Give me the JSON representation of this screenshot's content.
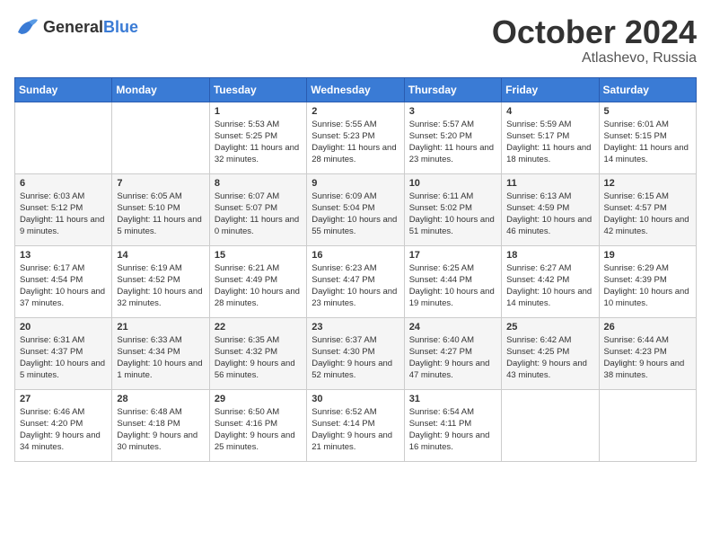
{
  "header": {
    "logo_general": "General",
    "logo_blue": "Blue",
    "month": "October 2024",
    "location": "Atlashevo, Russia"
  },
  "days_of_week": [
    "Sunday",
    "Monday",
    "Tuesday",
    "Wednesday",
    "Thursday",
    "Friday",
    "Saturday"
  ],
  "weeks": [
    [
      {
        "day": "",
        "sunrise": "",
        "sunset": "",
        "daylight": ""
      },
      {
        "day": "",
        "sunrise": "",
        "sunset": "",
        "daylight": ""
      },
      {
        "day": "1",
        "sunrise": "Sunrise: 5:53 AM",
        "sunset": "Sunset: 5:25 PM",
        "daylight": "Daylight: 11 hours and 32 minutes."
      },
      {
        "day": "2",
        "sunrise": "Sunrise: 5:55 AM",
        "sunset": "Sunset: 5:23 PM",
        "daylight": "Daylight: 11 hours and 28 minutes."
      },
      {
        "day": "3",
        "sunrise": "Sunrise: 5:57 AM",
        "sunset": "Sunset: 5:20 PM",
        "daylight": "Daylight: 11 hours and 23 minutes."
      },
      {
        "day": "4",
        "sunrise": "Sunrise: 5:59 AM",
        "sunset": "Sunset: 5:17 PM",
        "daylight": "Daylight: 11 hours and 18 minutes."
      },
      {
        "day": "5",
        "sunrise": "Sunrise: 6:01 AM",
        "sunset": "Sunset: 5:15 PM",
        "daylight": "Daylight: 11 hours and 14 minutes."
      }
    ],
    [
      {
        "day": "6",
        "sunrise": "Sunrise: 6:03 AM",
        "sunset": "Sunset: 5:12 PM",
        "daylight": "Daylight: 11 hours and 9 minutes."
      },
      {
        "day": "7",
        "sunrise": "Sunrise: 6:05 AM",
        "sunset": "Sunset: 5:10 PM",
        "daylight": "Daylight: 11 hours and 5 minutes."
      },
      {
        "day": "8",
        "sunrise": "Sunrise: 6:07 AM",
        "sunset": "Sunset: 5:07 PM",
        "daylight": "Daylight: 11 hours and 0 minutes."
      },
      {
        "day": "9",
        "sunrise": "Sunrise: 6:09 AM",
        "sunset": "Sunset: 5:04 PM",
        "daylight": "Daylight: 10 hours and 55 minutes."
      },
      {
        "day": "10",
        "sunrise": "Sunrise: 6:11 AM",
        "sunset": "Sunset: 5:02 PM",
        "daylight": "Daylight: 10 hours and 51 minutes."
      },
      {
        "day": "11",
        "sunrise": "Sunrise: 6:13 AM",
        "sunset": "Sunset: 4:59 PM",
        "daylight": "Daylight: 10 hours and 46 minutes."
      },
      {
        "day": "12",
        "sunrise": "Sunrise: 6:15 AM",
        "sunset": "Sunset: 4:57 PM",
        "daylight": "Daylight: 10 hours and 42 minutes."
      }
    ],
    [
      {
        "day": "13",
        "sunrise": "Sunrise: 6:17 AM",
        "sunset": "Sunset: 4:54 PM",
        "daylight": "Daylight: 10 hours and 37 minutes."
      },
      {
        "day": "14",
        "sunrise": "Sunrise: 6:19 AM",
        "sunset": "Sunset: 4:52 PM",
        "daylight": "Daylight: 10 hours and 32 minutes."
      },
      {
        "day": "15",
        "sunrise": "Sunrise: 6:21 AM",
        "sunset": "Sunset: 4:49 PM",
        "daylight": "Daylight: 10 hours and 28 minutes."
      },
      {
        "day": "16",
        "sunrise": "Sunrise: 6:23 AM",
        "sunset": "Sunset: 4:47 PM",
        "daylight": "Daylight: 10 hours and 23 minutes."
      },
      {
        "day": "17",
        "sunrise": "Sunrise: 6:25 AM",
        "sunset": "Sunset: 4:44 PM",
        "daylight": "Daylight: 10 hours and 19 minutes."
      },
      {
        "day": "18",
        "sunrise": "Sunrise: 6:27 AM",
        "sunset": "Sunset: 4:42 PM",
        "daylight": "Daylight: 10 hours and 14 minutes."
      },
      {
        "day": "19",
        "sunrise": "Sunrise: 6:29 AM",
        "sunset": "Sunset: 4:39 PM",
        "daylight": "Daylight: 10 hours and 10 minutes."
      }
    ],
    [
      {
        "day": "20",
        "sunrise": "Sunrise: 6:31 AM",
        "sunset": "Sunset: 4:37 PM",
        "daylight": "Daylight: 10 hours and 5 minutes."
      },
      {
        "day": "21",
        "sunrise": "Sunrise: 6:33 AM",
        "sunset": "Sunset: 4:34 PM",
        "daylight": "Daylight: 10 hours and 1 minute."
      },
      {
        "day": "22",
        "sunrise": "Sunrise: 6:35 AM",
        "sunset": "Sunset: 4:32 PM",
        "daylight": "Daylight: 9 hours and 56 minutes."
      },
      {
        "day": "23",
        "sunrise": "Sunrise: 6:37 AM",
        "sunset": "Sunset: 4:30 PM",
        "daylight": "Daylight: 9 hours and 52 minutes."
      },
      {
        "day": "24",
        "sunrise": "Sunrise: 6:40 AM",
        "sunset": "Sunset: 4:27 PM",
        "daylight": "Daylight: 9 hours and 47 minutes."
      },
      {
        "day": "25",
        "sunrise": "Sunrise: 6:42 AM",
        "sunset": "Sunset: 4:25 PM",
        "daylight": "Daylight: 9 hours and 43 minutes."
      },
      {
        "day": "26",
        "sunrise": "Sunrise: 6:44 AM",
        "sunset": "Sunset: 4:23 PM",
        "daylight": "Daylight: 9 hours and 38 minutes."
      }
    ],
    [
      {
        "day": "27",
        "sunrise": "Sunrise: 6:46 AM",
        "sunset": "Sunset: 4:20 PM",
        "daylight": "Daylight: 9 hours and 34 minutes."
      },
      {
        "day": "28",
        "sunrise": "Sunrise: 6:48 AM",
        "sunset": "Sunset: 4:18 PM",
        "daylight": "Daylight: 9 hours and 30 minutes."
      },
      {
        "day": "29",
        "sunrise": "Sunrise: 6:50 AM",
        "sunset": "Sunset: 4:16 PM",
        "daylight": "Daylight: 9 hours and 25 minutes."
      },
      {
        "day": "30",
        "sunrise": "Sunrise: 6:52 AM",
        "sunset": "Sunset: 4:14 PM",
        "daylight": "Daylight: 9 hours and 21 minutes."
      },
      {
        "day": "31",
        "sunrise": "Sunrise: 6:54 AM",
        "sunset": "Sunset: 4:11 PM",
        "daylight": "Daylight: 9 hours and 16 minutes."
      },
      {
        "day": "",
        "sunrise": "",
        "sunset": "",
        "daylight": ""
      },
      {
        "day": "",
        "sunrise": "",
        "sunset": "",
        "daylight": ""
      }
    ]
  ]
}
